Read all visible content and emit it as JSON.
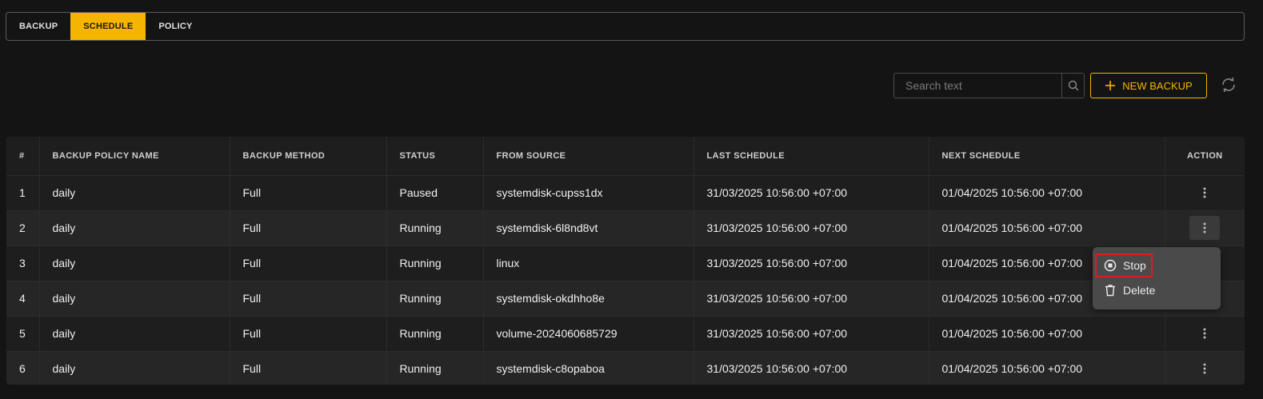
{
  "tabs": [
    {
      "label": "BACKUP"
    },
    {
      "label": "SCHEDULE"
    },
    {
      "label": "POLICY"
    }
  ],
  "active_tab": "SCHEDULE",
  "search": {
    "placeholder": "Search text",
    "value": ""
  },
  "new_button": {
    "label": "NEW BACKUP"
  },
  "colors": {
    "accent": "#f5b400",
    "highlight": "#e21b1b"
  },
  "icons": {
    "search": "search-icon",
    "add": "plus-icon",
    "refresh": "refresh-icon",
    "more": "kebab-icon",
    "stop": "stop-icon",
    "delete": "trash-icon"
  },
  "table": {
    "headers": [
      "#",
      "BACKUP POLICY NAME",
      "BACKUP METHOD",
      "STATUS",
      "FROM SOURCE",
      "LAST SCHEDULE",
      "NEXT SCHEDULE",
      "ACTION"
    ],
    "rows": [
      {
        "n": "1",
        "name": "daily",
        "method": "Full",
        "status": "Paused",
        "source": "systemdisk-cupss1dx",
        "last": "31/03/2025 10:56:00 +07:00",
        "next": "01/04/2025 10:56:00 +07:00"
      },
      {
        "n": "2",
        "name": "daily",
        "method": "Full",
        "status": "Running",
        "source": "systemdisk-6l8nd8vt",
        "last": "31/03/2025 10:56:00 +07:00",
        "next": "01/04/2025 10:56:00 +07:00"
      },
      {
        "n": "3",
        "name": "daily",
        "method": "Full",
        "status": "Running",
        "source": "linux",
        "last": "31/03/2025 10:56:00 +07:00",
        "next": "01/04/2025 10:56:00 +07:00"
      },
      {
        "n": "4",
        "name": "daily",
        "method": "Full",
        "status": "Running",
        "source": "systemdisk-okdhho8e",
        "last": "31/03/2025 10:56:00 +07:00",
        "next": "01/04/2025 10:56:00 +07:00"
      },
      {
        "n": "5",
        "name": "daily",
        "method": "Full",
        "status": "Running",
        "source": "volume-2024060685729",
        "last": "31/03/2025 10:56:00 +07:00",
        "next": "01/04/2025 10:56:00 +07:00"
      },
      {
        "n": "6",
        "name": "daily",
        "method": "Full",
        "status": "Running",
        "source": "systemdisk-c8opaboa",
        "last": "31/03/2025 10:56:00 +07:00",
        "next": "01/04/2025 10:56:00 +07:00"
      }
    ]
  },
  "action_menu": {
    "items": [
      {
        "label": "Stop"
      },
      {
        "label": "Delete"
      }
    ]
  }
}
